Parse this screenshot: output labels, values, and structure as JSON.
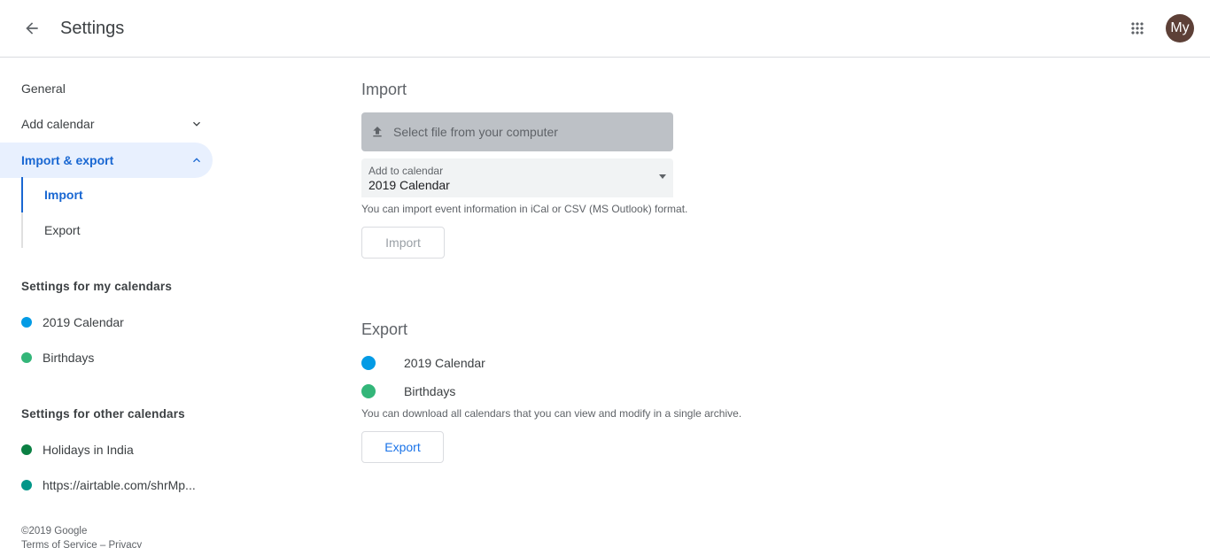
{
  "header": {
    "title": "Settings",
    "avatar_initials": "My"
  },
  "sidebar": {
    "general": "General",
    "add_calendar": "Add calendar",
    "import_export": "Import & export",
    "import": "Import",
    "export": "Export",
    "my_calendars_heading": "Settings for my calendars",
    "my_calendars": [
      {
        "label": "2019 Calendar",
        "color": "#039be5"
      },
      {
        "label": "Birthdays",
        "color": "#33b679"
      }
    ],
    "other_calendars_heading": "Settings for other calendars",
    "other_calendars": [
      {
        "label": "Holidays in India",
        "color": "#0b8043"
      },
      {
        "label": "https://airtable.com/shrMp...",
        "color": "#009688"
      }
    ],
    "footer": {
      "copyright": "©2019 Google",
      "terms": "Terms of Service",
      "separator": "–",
      "privacy": "Privacy"
    }
  },
  "main": {
    "import": {
      "heading": "Import",
      "select_file_label": "Select file from your computer",
      "add_to_calendar_label": "Add to calendar",
      "add_to_calendar_value": "2019 Calendar",
      "hint": "You can import event information in iCal or CSV (MS Outlook) format.",
      "button_label": "Import"
    },
    "export": {
      "heading": "Export",
      "calendars": [
        {
          "label": "2019 Calendar",
          "color": "#039be5"
        },
        {
          "label": "Birthdays",
          "color": "#33b679"
        }
      ],
      "hint": "You can download all calendars that you can view and modify in a single archive.",
      "button_label": "Export"
    }
  }
}
